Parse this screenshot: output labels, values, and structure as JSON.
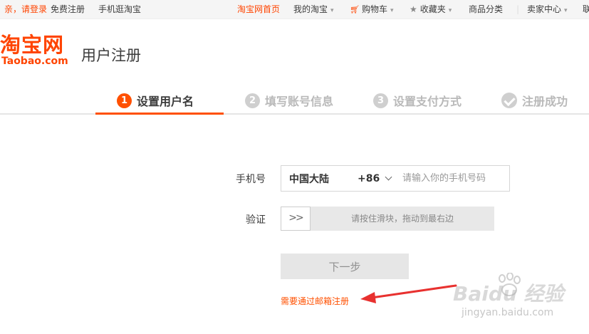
{
  "topbar": {
    "greeting": "亲，请登录",
    "register": "免费注册",
    "mobile": "手机逛淘宝",
    "home": "淘宝网首页",
    "my_taobao": "我的淘宝",
    "cart": "购物车",
    "favorites": "收藏夹",
    "categories": "商品分类",
    "seller": "卖家中心",
    "cut_off": "联"
  },
  "header": {
    "logo_cn": "淘宝网",
    "logo_en": "Taobao.com",
    "title": "用户注册"
  },
  "steps": [
    {
      "num": "1",
      "label": "设置用户名",
      "state": "active"
    },
    {
      "num": "2",
      "label": "填写账号信息",
      "state": "pending"
    },
    {
      "num": "3",
      "label": "设置支付方式",
      "state": "pending"
    },
    {
      "num": "",
      "label": "注册成功",
      "state": "pending"
    }
  ],
  "form": {
    "phone_label": "手机号",
    "country": "中国大陆",
    "country_code": "+86",
    "phone_placeholder": "请输入你的手机号码",
    "verify_label": "验证",
    "slider_handle": ">>",
    "slider_hint": "请按住滑块，拖动到最右边",
    "next_button": "下一步",
    "email_link": "需要通过邮箱注册"
  },
  "watermark": {
    "brand": "Baidu 经验",
    "url": "jingyan.baidu.com"
  },
  "colors": {
    "accent": "#ff5000",
    "logo": "#ff4400",
    "annotation_arrow": "#e8312f"
  },
  "icons": [
    "cart-icon",
    "star-icon",
    "chevron-down-icon",
    "check-icon",
    "slider-arrows-icon",
    "baidu-paw-icon"
  ]
}
